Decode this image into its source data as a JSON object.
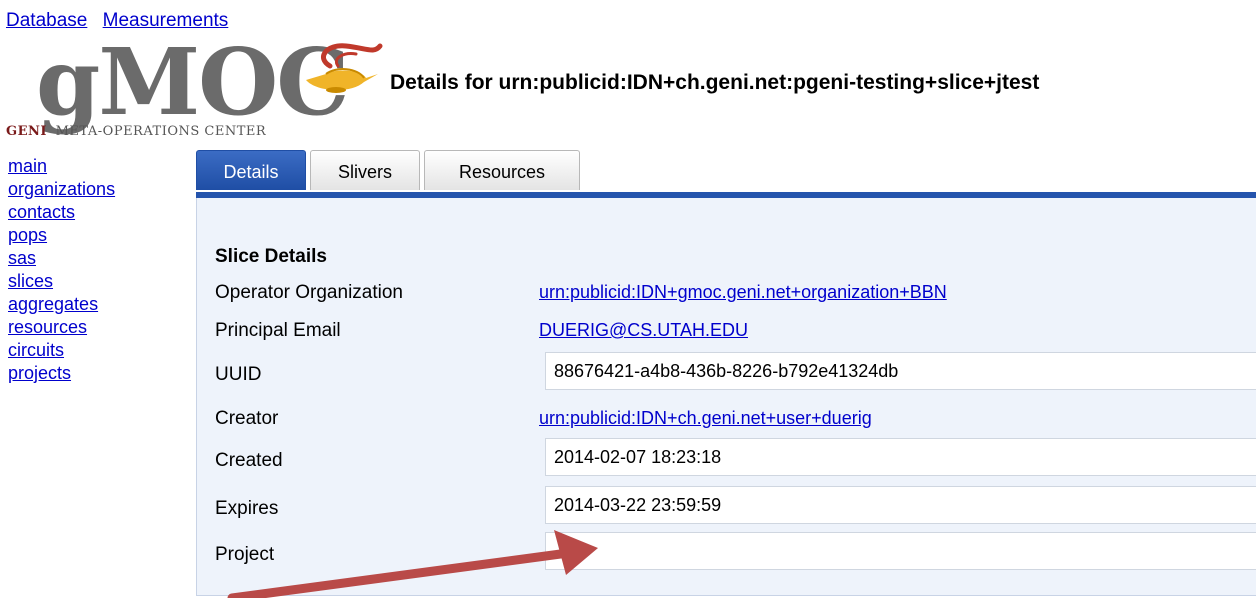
{
  "topnav": {
    "database": "Database",
    "measurements": "Measurements"
  },
  "logo": {
    "mark": "gMOC",
    "geni": "GENI",
    "subtitle": "META-OPERATIONS CENTER"
  },
  "page_title": "Details for urn:publicid:IDN+ch.geni.net:pgeni-testing+slice+jtest",
  "sidenav": [
    "main",
    "organizations",
    "contacts",
    "pops",
    "sas",
    "slices",
    "aggregates",
    "resources",
    "circuits",
    "projects"
  ],
  "tabs": {
    "details": "Details",
    "slivers": "Slivers",
    "resources": "Resources"
  },
  "section_title": "Slice Details",
  "rows": {
    "operator_org": {
      "label": "Operator Organization",
      "value": "urn:publicid:IDN+gmoc.geni.net+organization+BBN"
    },
    "principal_email": {
      "label": "Principal Email",
      "value": "DUERIG@CS.UTAH.EDU"
    },
    "uuid": {
      "label": "UUID",
      "value": "88676421-a4b8-436b-8226-b792e41324db"
    },
    "creator": {
      "label": "Creator",
      "value": "urn:publicid:IDN+ch.geni.net+user+duerig"
    },
    "created": {
      "label": "Created",
      "value": "2014-02-07 18:23:18"
    },
    "expires": {
      "label": "Expires",
      "value": "2014-03-22 23:59:59"
    },
    "project": {
      "label": "Project",
      "value": ""
    }
  },
  "colors": {
    "tab_active": "#2454ad",
    "panel_bg": "#eef3fb",
    "link": "#0000cc",
    "arrow": "#b94a48",
    "logo_red": "#c0392b",
    "lamp_gold": "#f0b429"
  },
  "icons": {
    "lamp": "genie-lamp-icon",
    "arrow": "annotation-arrow"
  }
}
